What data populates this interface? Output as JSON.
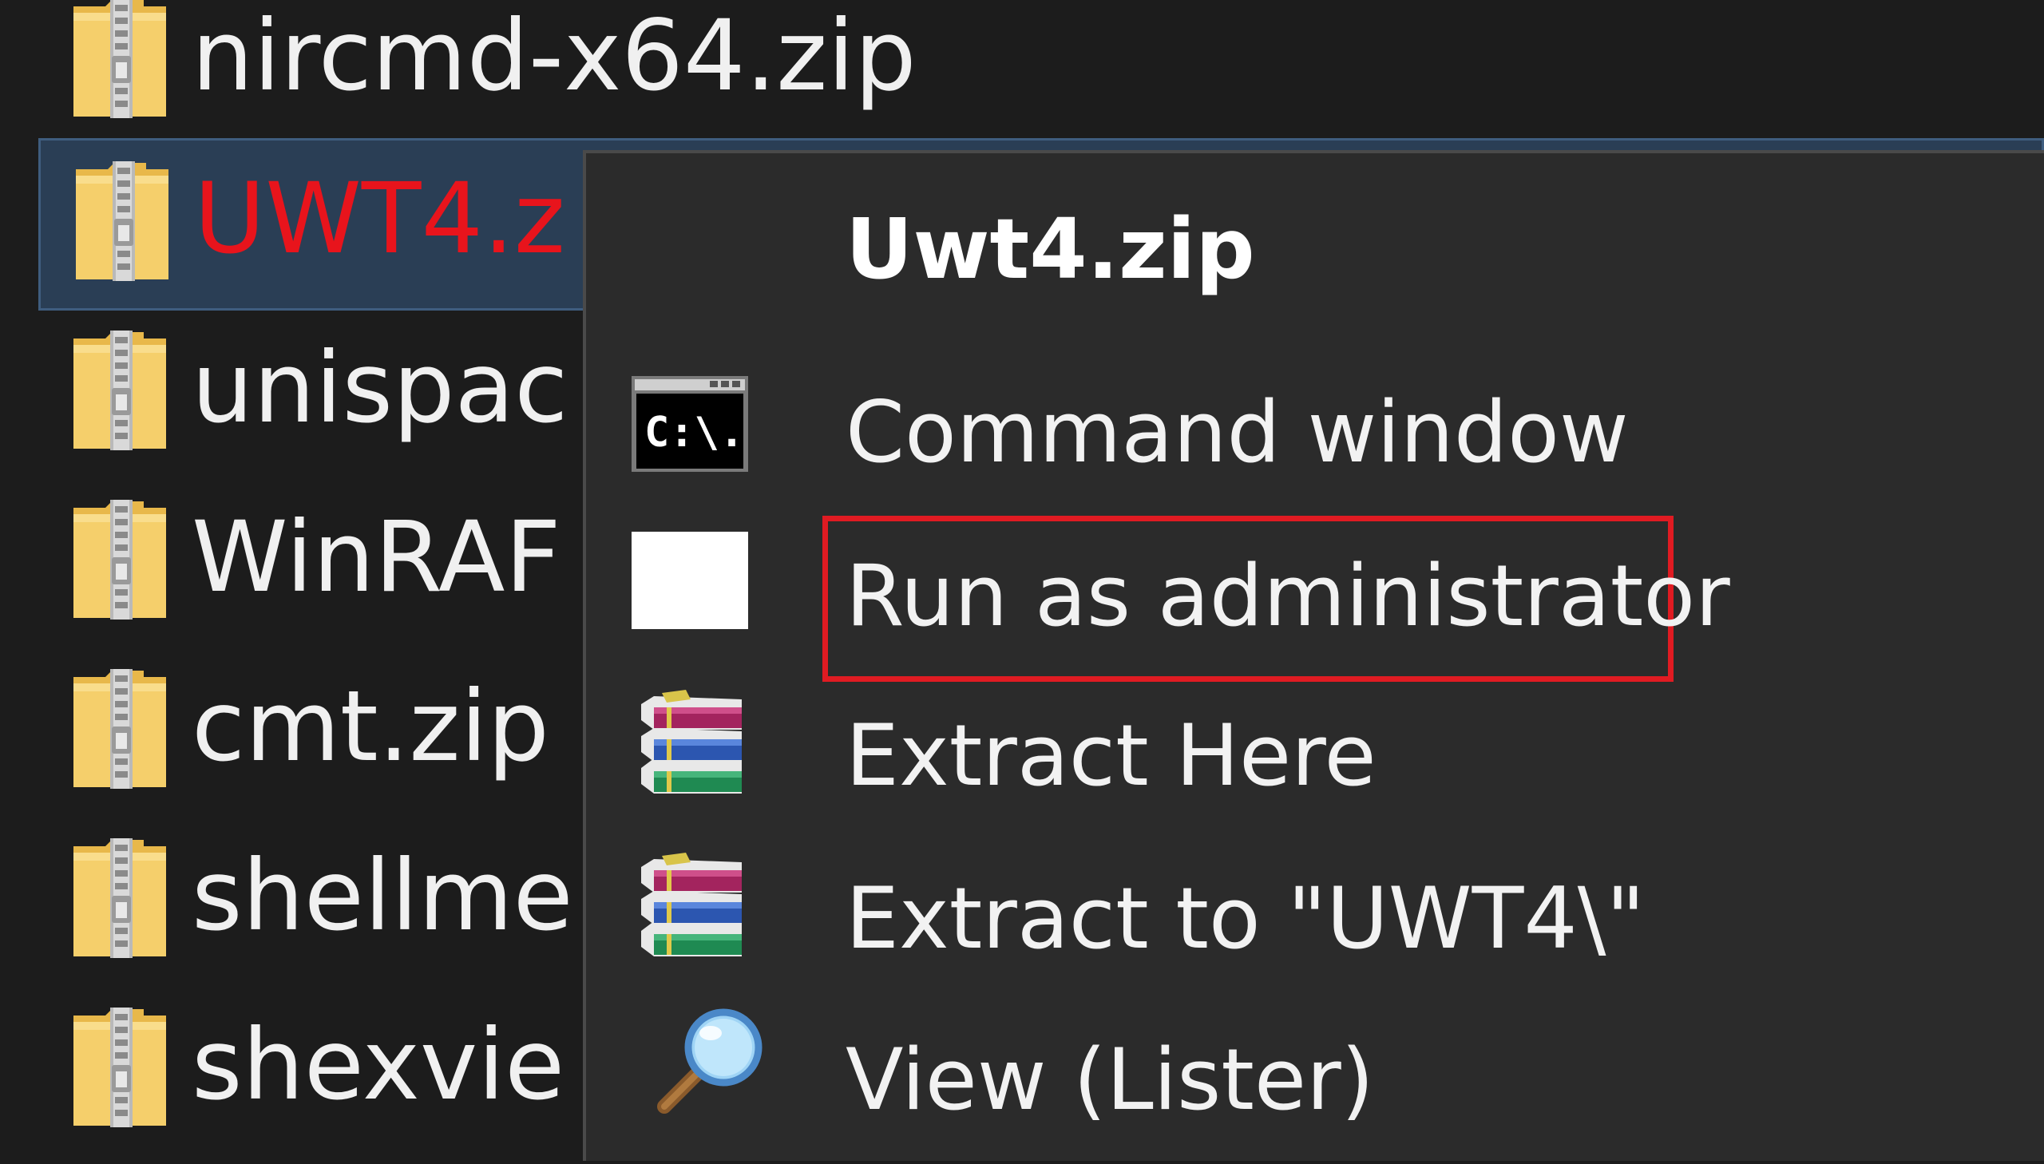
{
  "files": [
    {
      "name": "nircmd-x64.zip",
      "selected": false
    },
    {
      "name": "UWT4.z",
      "selected": true
    },
    {
      "name": "unispac",
      "selected": false
    },
    {
      "name": "WinRAF",
      "selected": false
    },
    {
      "name": "cmt.zip",
      "selected": false
    },
    {
      "name": "shellme",
      "selected": false
    },
    {
      "name": "shexvie",
      "selected": false
    }
  ],
  "context_menu": {
    "title": "Uwt4.zip",
    "items": [
      {
        "label": "Command window",
        "icon": "command-prompt-icon"
      },
      {
        "label": "Run as administrator",
        "icon": "blank-icon",
        "highlighted": true
      },
      {
        "label": "Extract Here",
        "icon": "winrar-icon"
      },
      {
        "label": "Extract to \"UWT4\\\"",
        "icon": "winrar-icon"
      },
      {
        "label": "View (Lister)",
        "icon": "magnifier-icon"
      }
    ],
    "cmd_icon_text": "C:\\.",
    "highlight_color": "#e01b22"
  },
  "colors": {
    "background": "#1c1c1c",
    "selected_row": "#2a3e55",
    "selected_text": "#e8141c",
    "menu_background": "#2b2b2b"
  }
}
